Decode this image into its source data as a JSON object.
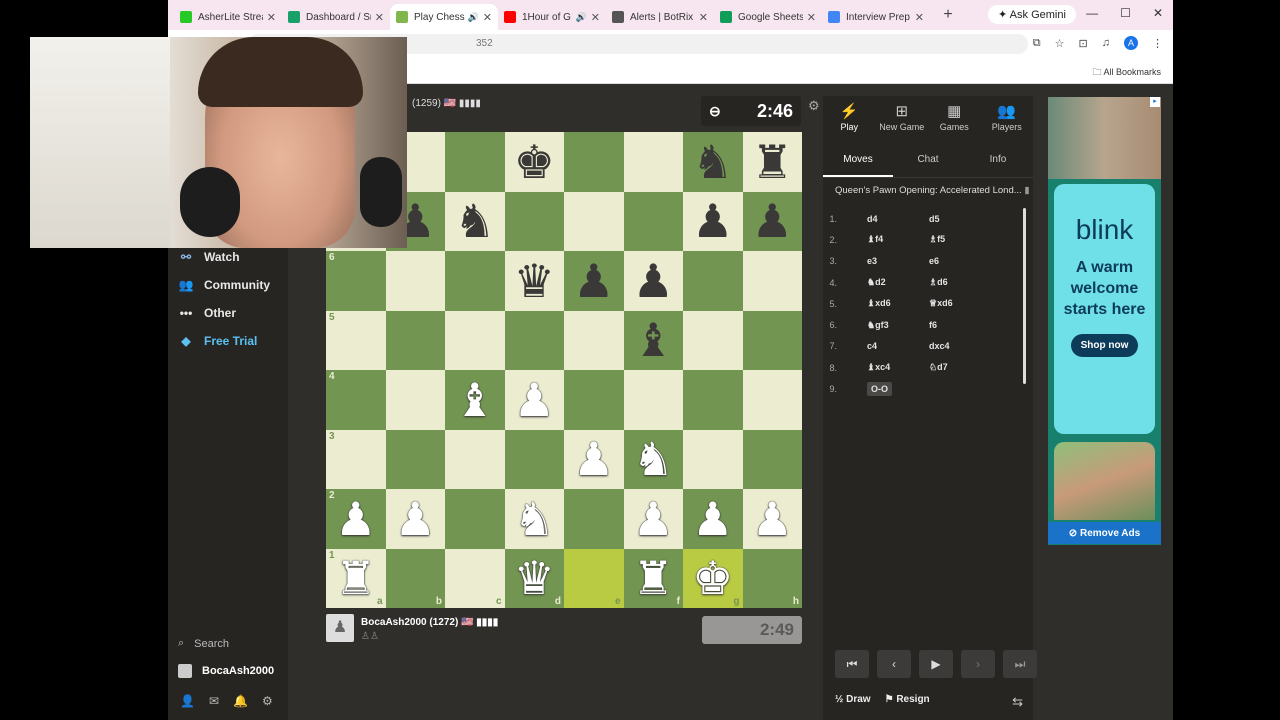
{
  "browser": {
    "tabs": [
      {
        "label": "AsherLite Strea",
        "color": "#26c926"
      },
      {
        "label": "Dashboard / Sr",
        "color": "#18a06a"
      },
      {
        "label": "Play Chess",
        "color": "#81b64c",
        "active": true,
        "audio": true
      },
      {
        "label": "1Hour of G",
        "color": "#ff0000",
        "audio": true
      },
      {
        "label": "Alerts | BotRix",
        "color": "#555555"
      },
      {
        "label": "Google Sheets",
        "color": "#0f9d58"
      },
      {
        "label": "Interview Prep",
        "color": "#4285f4"
      }
    ],
    "gemini_label": "Ask Gemini",
    "url_fragment": "352",
    "all_bookmarks": "All Bookmarks",
    "profile_initial": "A"
  },
  "nav": {
    "items": [
      {
        "label": "Watch",
        "icon": "binoculars-icon"
      },
      {
        "label": "Community",
        "icon": "community-icon"
      },
      {
        "label": "Other",
        "icon": "more-icon"
      },
      {
        "label": "Free Trial",
        "icon": "diamond-icon"
      }
    ],
    "search_label": "Search",
    "username": "BocaAsh2000"
  },
  "opponent": {
    "info": "(1259) 🇺🇸 ▮▮▮▮",
    "clock": "2:46"
  },
  "player": {
    "name": "BocaAsh2000 (1272) 🇺🇸 ▮▮▮▮",
    "captured": "♙♙",
    "clock": "2:49"
  },
  "board": {
    "highlight_squares": [
      "e1",
      "g1"
    ],
    "light": "#ebecd0",
    "dark": "#739552",
    "highlight": "#b9ca43",
    "pieces": {
      "a1": "wR",
      "d1": "wQ",
      "f1": "wR",
      "g1": "wK",
      "a2": "wP",
      "b2": "wP",
      "d2": "wN",
      "f2": "wP",
      "g2": "wP",
      "h2": "wP",
      "e3": "wP",
      "f3": "wN",
      "c4": "wB",
      "d4": "wP",
      "f5": "bB",
      "d6": "bQ",
      "e6": "bP",
      "f6": "bP",
      "a7": "bP",
      "b7": "bP",
      "c7": "bN",
      "g7": "bP",
      "h7": "bP",
      "d8": "bK",
      "g8": "bN",
      "h8": "bR"
    },
    "rank_labels": [
      "1",
      "2",
      "3",
      "4",
      "5",
      "6"
    ],
    "file_labels": [
      "a",
      "b",
      "c",
      "d",
      "e",
      "f",
      "g",
      "h"
    ]
  },
  "panel": {
    "tabs": [
      {
        "label": "Play",
        "icon": "lightning-icon",
        "active": true
      },
      {
        "label": "New Game",
        "icon": "plus-icon"
      },
      {
        "label": "Games",
        "icon": "grid-icon"
      },
      {
        "label": "Players",
        "icon": "players-icon"
      }
    ],
    "subtabs": [
      {
        "label": "Moves",
        "active": true
      },
      {
        "label": "Chat"
      },
      {
        "label": "Info"
      }
    ],
    "opening": "Queen's Pawn Opening: Accelerated Lond...",
    "moves": [
      {
        "num": "1.",
        "white": "d4",
        "black": "d5"
      },
      {
        "num": "2.",
        "white": "♝f4",
        "black": "♗f5"
      },
      {
        "num": "3.",
        "white": "e3",
        "black": "e6"
      },
      {
        "num": "4.",
        "white": "♞d2",
        "black": "♗d6"
      },
      {
        "num": "5.",
        "white": "♝xd6",
        "black": "♕xd6"
      },
      {
        "num": "6.",
        "white": "♞gf3",
        "black": "f6"
      },
      {
        "num": "7.",
        "white": "c4",
        "black": "dxc4"
      },
      {
        "num": "8.",
        "white": "♝xc4",
        "black": "♘d7"
      },
      {
        "num": "9.",
        "white": "O-O",
        "black": ""
      }
    ],
    "draw_label": "Draw",
    "resign_label": "Resign"
  },
  "ad": {
    "brand": "blink",
    "tagline": "A warm welcome starts here",
    "cta": "Shop now",
    "remove_ads": "Remove Ads"
  }
}
